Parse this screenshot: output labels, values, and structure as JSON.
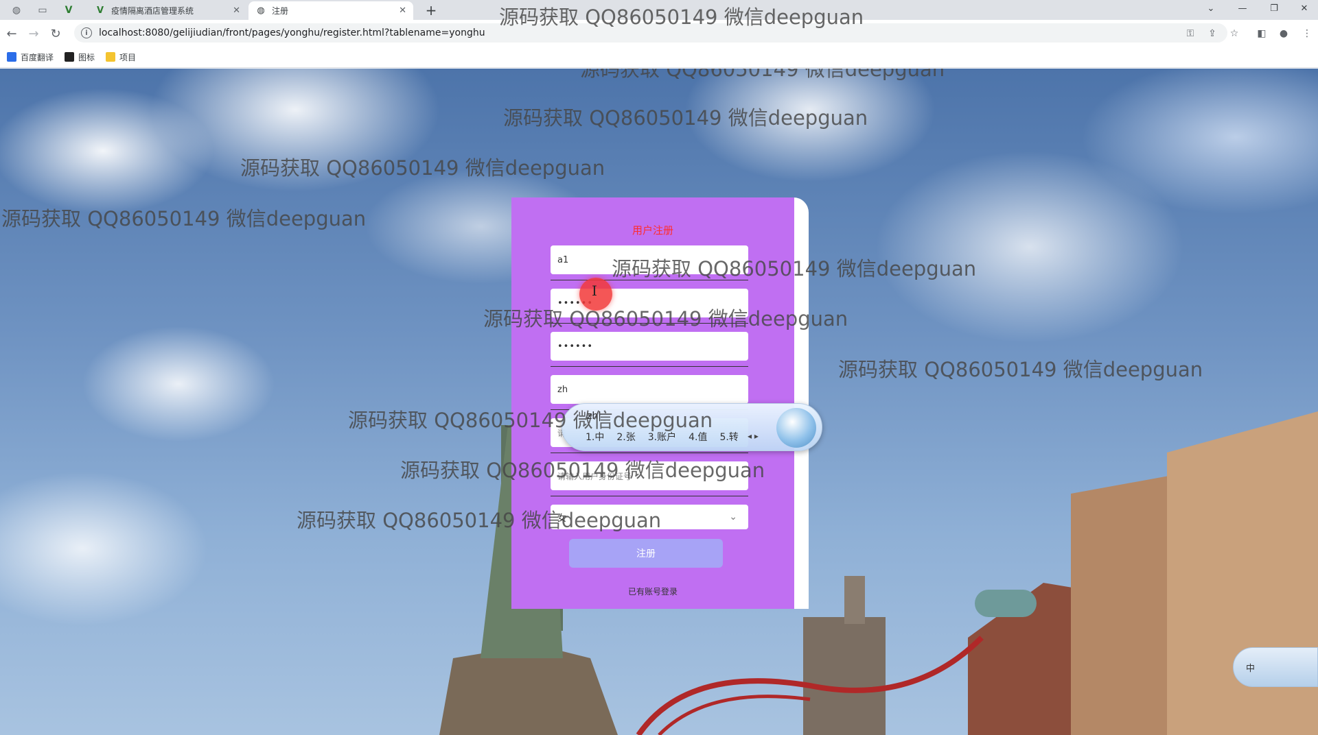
{
  "browser": {
    "tabs": [
      {
        "title": "疫情隔离酒店管理系统"
      },
      {
        "title": "注册"
      }
    ],
    "url": "localhost:8080/gelijiudian/front/pages/yonghu/register.html?tablename=yonghu",
    "bookmarks": [
      {
        "label": "百度翻译",
        "color": "#2b6de8"
      },
      {
        "label": "图标",
        "color": "#222222"
      },
      {
        "label": "项目",
        "color": "#f4c430"
      }
    ]
  },
  "watermark_text": "源码获取 QQ86050149 微信deepguan",
  "form": {
    "title": "用户注册",
    "username_value": "a1",
    "password_value": "••••••",
    "confirm_password_value": "••••••",
    "name_value": "zh",
    "phone_partial": "请",
    "idcard_placeholder": "请输入用户身份证号",
    "gender_value": "女",
    "submit_label": "注册",
    "login_link": "已有账号登录"
  },
  "ime": {
    "input": "zh|",
    "candidates": [
      "1.中",
      "2.张",
      "3.账户",
      "4.值",
      "5.转"
    ],
    "status_label": "中"
  },
  "colors": {
    "card": "#c06ff2",
    "title": "#ff2c2c",
    "submit": "#a7a3f6"
  }
}
